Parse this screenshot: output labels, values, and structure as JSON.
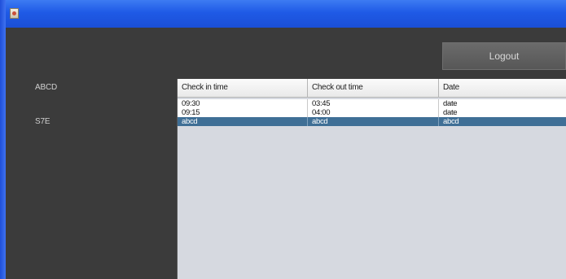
{
  "window": {
    "title": "",
    "icon": "java-app-icon",
    "titlebar_color": "#1f5ae6",
    "background_color": "#3b3b3b"
  },
  "logout_button": {
    "label": "Logout"
  },
  "info": {
    "name": "ABCD",
    "id": "S7E"
  },
  "table": {
    "columns": [
      "Check in time",
      "Check out time",
      "Date"
    ],
    "rows": [
      [
        "09:30",
        "03:45",
        "date"
      ],
      [
        "09:15",
        "04:00",
        "date"
      ],
      [
        "abcd",
        "abcd",
        "abcd"
      ]
    ],
    "selected_row": 2,
    "selection_color": "#3f6f96"
  }
}
